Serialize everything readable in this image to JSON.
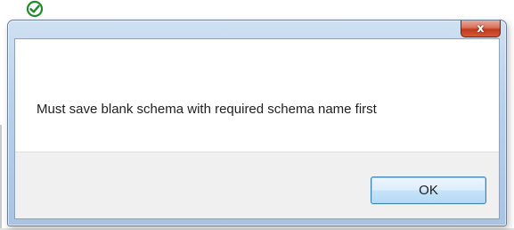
{
  "dialog": {
    "message": "Must save blank schema with required schema name first",
    "ok_label": "OK",
    "close_glyph": "x"
  },
  "icons": {
    "top_icon": "checkmark-circle-icon",
    "close_icon": "close-icon"
  },
  "colors": {
    "check_green": "#1e8a2e",
    "close_red": "#c23a1c",
    "ok_border": "#3c7fb1",
    "frame_blue": "#bad1ea"
  }
}
